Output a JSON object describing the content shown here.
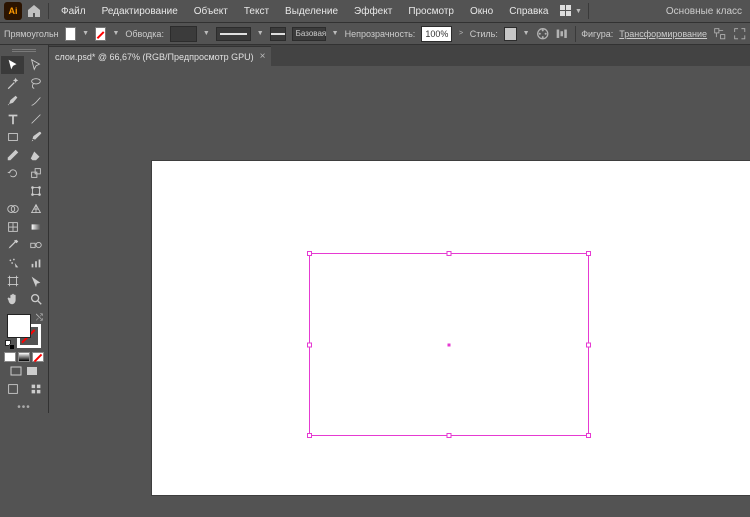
{
  "menu": {
    "items": [
      "Файл",
      "Редактирование",
      "Объект",
      "Текст",
      "Выделение",
      "Эффект",
      "Просмотр",
      "Окно",
      "Справка"
    ],
    "right": "Основные класс"
  },
  "controlbar": {
    "shape": "Прямоугольн",
    "stroke_label": "Обводка:",
    "stroke_pt": "   ",
    "brush_label": "Базовая",
    "opacity_label": "Непрозрачность:",
    "opacity_value": "100%",
    "style_label": "Стиль:",
    "shape_label": "Фигура:",
    "transform_label": "Трансформирование"
  },
  "tab": {
    "title": "слои.psd* @ 66,67% (RGB/Предпросмотр GPU)"
  },
  "colors": {
    "selection": "#e63ad2",
    "artboard_border": "#ec3ecf"
  },
  "tools": [
    [
      "selection",
      "direct-selection"
    ],
    [
      "magic-wand",
      "lasso"
    ],
    [
      "pen",
      "curvature"
    ],
    [
      "type",
      "line-segment"
    ],
    [
      "rectangle",
      "paintbrush"
    ],
    [
      "pencil",
      "eraser"
    ],
    [
      "rotate",
      "scale"
    ],
    [
      "width",
      "free-transform"
    ],
    [
      "shape-builder",
      "perspective"
    ],
    [
      "mesh",
      "gradient"
    ],
    [
      "eyedropper",
      "blend"
    ],
    [
      "symbol-sprayer",
      "column-graph"
    ],
    [
      "artboard",
      "slice"
    ],
    [
      "hand",
      "zoom"
    ]
  ]
}
